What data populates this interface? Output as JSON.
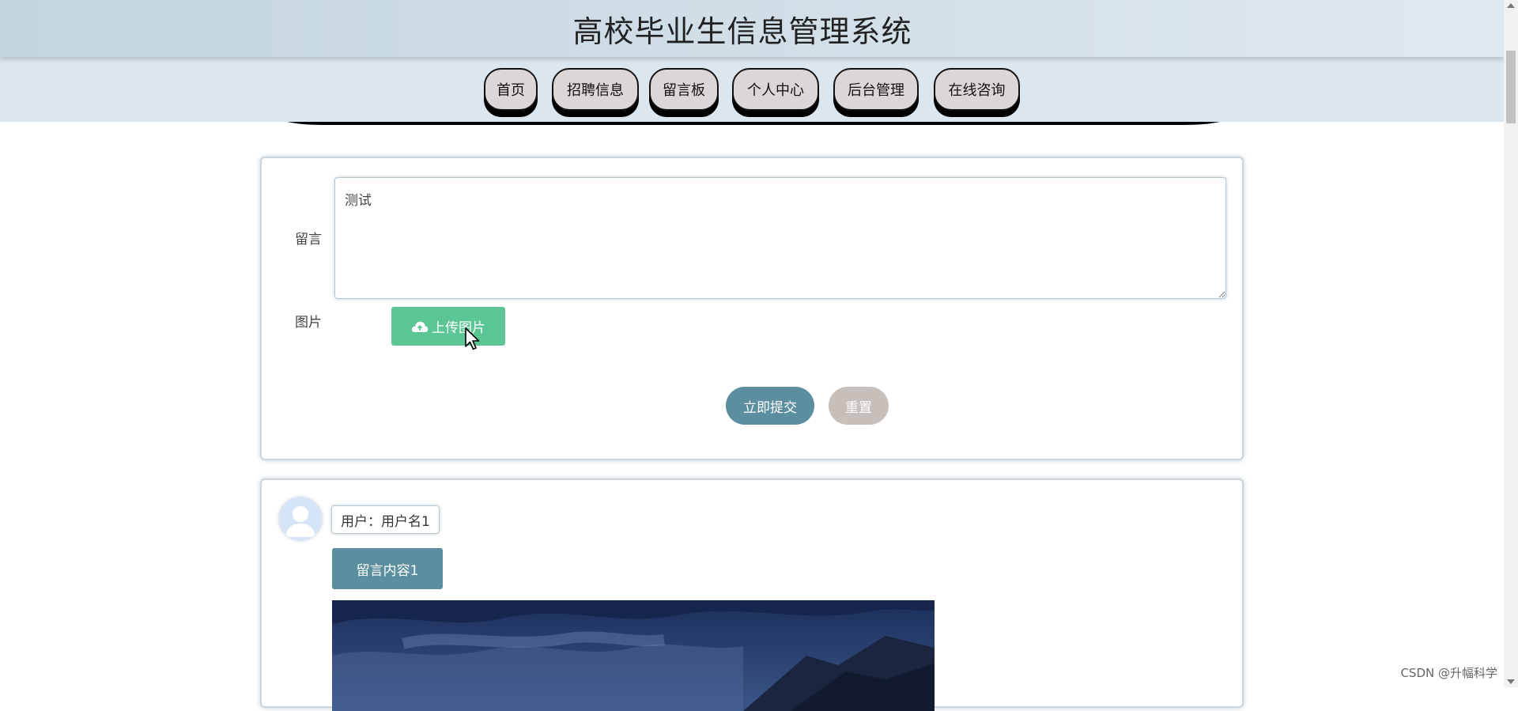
{
  "header": {
    "title": "高校毕业生信息管理系统"
  },
  "nav": {
    "items": [
      {
        "label": "首页"
      },
      {
        "label": "招聘信息"
      },
      {
        "label": "留言板"
      },
      {
        "label": "个人中心"
      },
      {
        "label": "后台管理"
      },
      {
        "label": "在线咨询"
      }
    ]
  },
  "form": {
    "message_label": "留言",
    "message_value": "测试",
    "image_label": "图片",
    "upload_label": "上传图片",
    "submit_label": "立即提交",
    "reset_label": "重置"
  },
  "messages": [
    {
      "user": "用户：用户名1",
      "content": "留言内容1"
    }
  ],
  "watermark": "CSDN @升幅科学",
  "colors": {
    "header_bg": "#c9d9e3",
    "nav_bg": "#dce6ef",
    "upload_green": "#5bc694",
    "primary_teal": "#5b8f9f",
    "reset_gray": "#c6bfba"
  }
}
